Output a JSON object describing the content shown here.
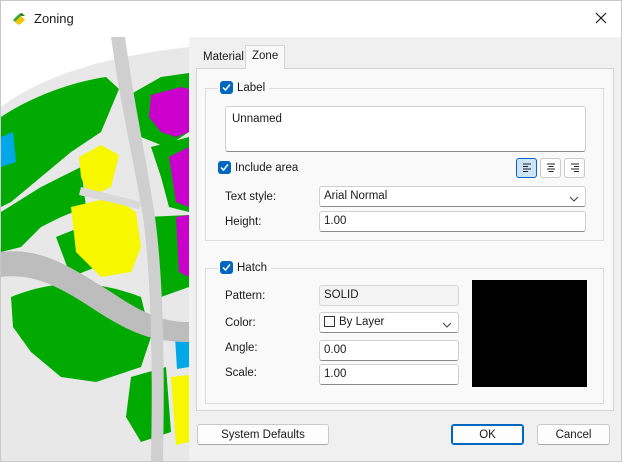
{
  "window": {
    "title": "Zoning",
    "icon": "app-logo-icon",
    "close_icon": "close-icon"
  },
  "tabs": [
    {
      "label": "Material",
      "active": false
    },
    {
      "label": "Zone",
      "active": true
    }
  ],
  "label_group": {
    "checkbox_label": "Label",
    "checked": true,
    "label_text": "Unnamed",
    "include_area": {
      "label": "Include area",
      "checked": true
    },
    "alignment": {
      "options": [
        "align-left-icon",
        "align-center-icon",
        "align-right-icon"
      ],
      "selected": "align-left-icon"
    },
    "text_style": {
      "label": "Text style:",
      "value": "Arial Normal"
    },
    "height": {
      "label": "Height:",
      "value": "1.00"
    }
  },
  "hatch_group": {
    "checkbox_label": "Hatch",
    "checked": true,
    "pattern": {
      "label": "Pattern:",
      "value": "SOLID"
    },
    "color": {
      "label": "Color:",
      "value": "By Layer"
    },
    "angle": {
      "label": "Angle:",
      "value": "0.00"
    },
    "scale": {
      "label": "Scale:",
      "value": "1.00"
    },
    "preview_color": "#000000"
  },
  "footer": {
    "system_defaults": "System Defaults",
    "ok": "OK",
    "cancel": "Cancel"
  },
  "colors": {
    "accent": "#0067c0",
    "map_green": "#00aa00",
    "map_yellow": "#f7f700",
    "map_magenta": "#cc00cc",
    "map_blue": "#00a8e8",
    "map_road": "#bdbdbd"
  }
}
